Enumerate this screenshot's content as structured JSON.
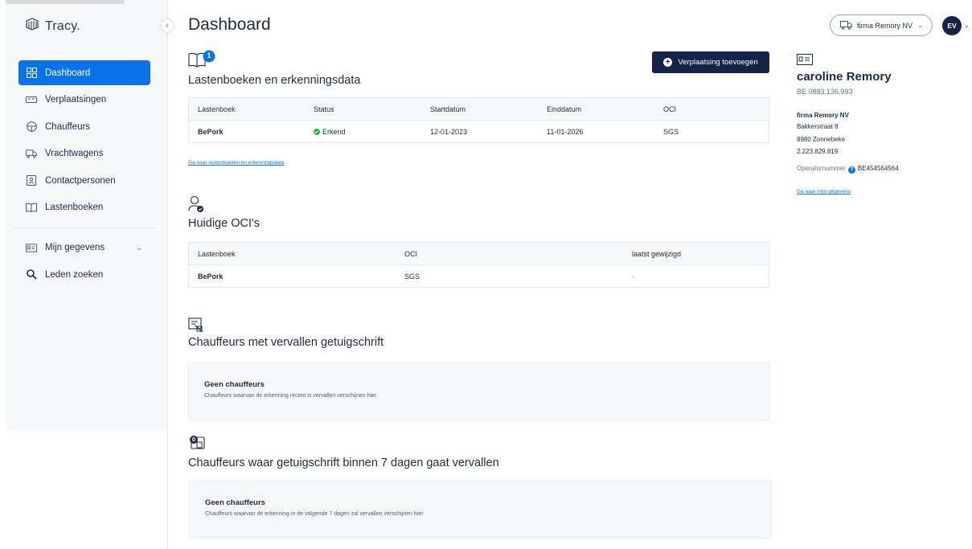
{
  "app": {
    "logo_text": "Tracy."
  },
  "sidebar": {
    "items": [
      {
        "label": "Dashboard",
        "icon": "dashboard-icon"
      },
      {
        "label": "Verplaatsingen",
        "icon": "transport-icon"
      },
      {
        "label": "Chauffeurs",
        "icon": "steering-wheel-icon"
      },
      {
        "label": "Vrachtwagens",
        "icon": "truck-icon"
      },
      {
        "label": "Contactpersonen",
        "icon": "contact-icon"
      },
      {
        "label": "Lastenboeken",
        "icon": "book-icon"
      }
    ],
    "secondary": [
      {
        "label": "Mijn gegevens",
        "icon": "id-card-icon"
      },
      {
        "label": "Leden zoeken",
        "icon": "search-icon"
      }
    ]
  },
  "header": {
    "title": "Dashboard",
    "company": "firma Remory NV",
    "avatar_initials": "EV"
  },
  "lastenboeken": {
    "badge_count": "1",
    "title": "Lastenboeken en erkenningsdata",
    "add_button": "Verplaatsing toevoegen",
    "columns": [
      "Lastenboek",
      "Status",
      "Startdatum",
      "Einddatum",
      "OCI"
    ],
    "rows": [
      {
        "lastenboek": "BePork",
        "status": "Erkend",
        "start": "12-01-2023",
        "end": "11-01-2026",
        "oci": "SGS"
      }
    ],
    "link": "Ga naar lastenboeken en erkenningsdata"
  },
  "ocis": {
    "title": "Huidige OCI's",
    "columns": [
      "Lastenboek",
      "OCI",
      "laatst gewijzigd"
    ],
    "rows": [
      {
        "lastenboek": "BePork",
        "oci": "SGS",
        "changed": "-"
      }
    ]
  },
  "expired": {
    "title": "Chauffeurs met vervallen getuigschrift",
    "empty_title": "Geen chauffeurs",
    "empty_desc": "Chauffeurs waarvan de erkenning recent is vervallen verschijnen hier"
  },
  "expiring": {
    "badge_count": "0",
    "title": "Chauffeurs waar getuigschrift binnen 7 dagen gaat vervallen",
    "empty_title": "Geen chauffeurs",
    "empty_desc": "Chauffeurs waarvan de erkenning in de volgende 7 dagen zal vervallen verschijnen hier"
  },
  "profile": {
    "name": "caroline Remory",
    "vat": "BE 0883.136.993",
    "company": "firma Remory NV",
    "street": "Bakkerstraat 8",
    "city": "8980 Zonnebeke",
    "phone": "2.223.829.819",
    "operator_label": "Operatornummer",
    "operator_value": "BE454564564",
    "link": "Ga naar mijn gegevens"
  },
  "colors": {
    "accent": "#0a73e8",
    "navy": "#142347",
    "success": "#2fa44f"
  }
}
